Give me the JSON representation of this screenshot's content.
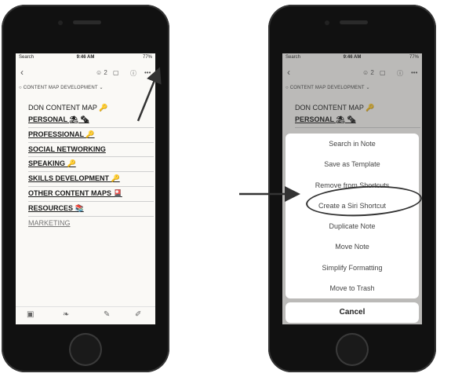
{
  "status_bar": {
    "carrier": "Search",
    "time": "9:46 AM",
    "battery": "77%"
  },
  "toolbar": {
    "share_count": "2"
  },
  "breadcrumb": "CONTENT MAP DEVELOPMENT",
  "note_lines": [
    "DON CONTENT MAP 🔑",
    "PERSONAL ⛱ 🗞",
    "PROFESSIONAL 🔑",
    "SOCIAL NETWORKING",
    "SPEAKING 🔑",
    "SKILLS DEVELOPMENT 🔑",
    "OTHER CONTENT MAPS 🎴",
    "RESOURCES 📚",
    "MARKETING"
  ],
  "right_note_lines": [
    "DON CONTENT MAP 🔑",
    "PERSONAL ⛱ 🗞"
  ],
  "actions": [
    "Search in Note",
    "Save as Template",
    "Remove from Shortcuts",
    "Create a Siri Shortcut",
    "Duplicate Note",
    "Move Note",
    "Simplify Formatting",
    "Move to Trash"
  ],
  "cancel_label": "Cancel",
  "icons": {
    "back": "chevron-left-icon",
    "share": "person-plus-icon",
    "edit": "compose-icon",
    "info": "info-icon",
    "more": "ellipsis-icon",
    "camera": "camera-icon",
    "pen": "pen-icon",
    "attach": "paperclip-icon"
  }
}
